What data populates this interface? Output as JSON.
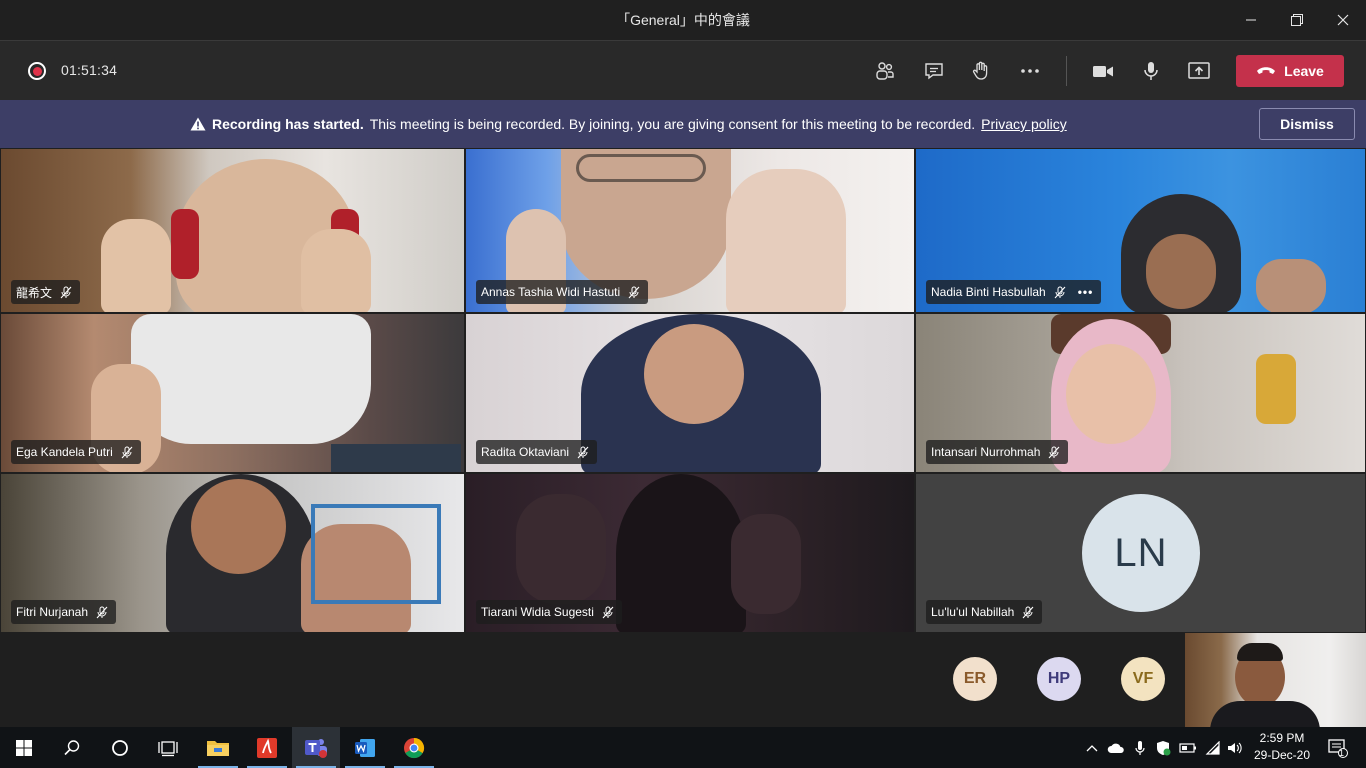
{
  "window": {
    "title": "「General」中的會議"
  },
  "toolbar": {
    "timer": "01:51:34",
    "leave_label": "Leave"
  },
  "banner": {
    "bold": "Recording has started.",
    "text": "This meeting is being recorded. By joining, you are giving consent for this meeting to be recorded.",
    "link": "Privacy policy",
    "dismiss_label": "Dismiss"
  },
  "participants": [
    {
      "name": "龍希文"
    },
    {
      "name": "Annas Tashia Widi Hastuti"
    },
    {
      "name": "Nadia Binti Hasbullah"
    },
    {
      "name": "Ega Kandela Putri"
    },
    {
      "name": "Radita Oktaviani"
    },
    {
      "name": "Intansari Nurrohmah"
    },
    {
      "name": "Fitri Nurjanah"
    },
    {
      "name": "Tiarani Widia Sugesti"
    },
    {
      "name": "Lu'lu'ul Nabillah",
      "initials": "LN"
    }
  ],
  "overflow_avatars": [
    {
      "initials": "ER",
      "bg": "#f2e0cc",
      "fg": "#8a5a2b"
    },
    {
      "initials": "HP",
      "bg": "#dcd9f0",
      "fg": "#3e3a7a"
    },
    {
      "initials": "VF",
      "bg": "#f3e3c0",
      "fg": "#8a6a1c"
    }
  ],
  "taskbar": {
    "time": "2:59 PM",
    "date": "29-Dec-20",
    "notification_count": "1"
  }
}
